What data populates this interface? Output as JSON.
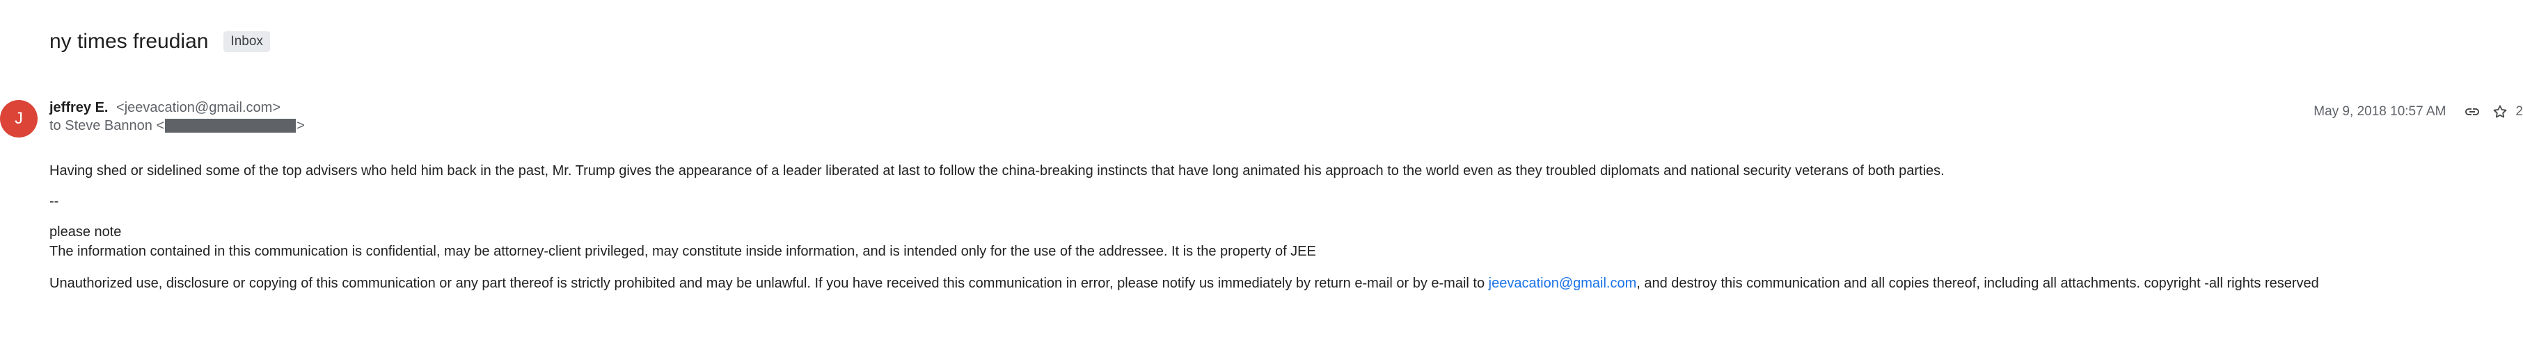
{
  "email": {
    "subject": "ny times freudian",
    "label": "Inbox",
    "sender": {
      "initial": "J",
      "name": "jeffrey E.",
      "email": "<jeevacation@gmail.com>",
      "avatar_color": "#db4437"
    },
    "recipient": {
      "prefix": "to Steve Bannon <",
      "suffix": ">"
    },
    "date": "May 9, 2018 10:57 AM",
    "trailing": "2",
    "icons": [
      "link-icon",
      "star-icon"
    ],
    "body": {
      "paragraph": "Having shed or sidelined some of the top advisers who held him back in the past, Mr. Trump gives the appearance of a leader liberated at last to follow the china-breaking instincts that have long animated his approach to the world even as they troubled diplomats and national security veterans of both parties.",
      "signature_separator": "--",
      "note_heading": "please note",
      "info_line": "The information contained in this communication is confidential, may be attorney-client privileged, may constitute inside information, and is intended only for the use of the addressee. It is the property of JEE",
      "disclaimer_before": "Unauthorized use, disclosure or copying of this communication or any part thereof is strictly prohibited and may be unlawful. If you have received this communication in error, please notify us immediately by return e-mail or by e-mail to ",
      "disclaimer_link": "jeevacation@gmail.com",
      "disclaimer_after": ", and destroy this communication and all copies thereof, including all attachments. copyright -all rights reserved"
    }
  }
}
